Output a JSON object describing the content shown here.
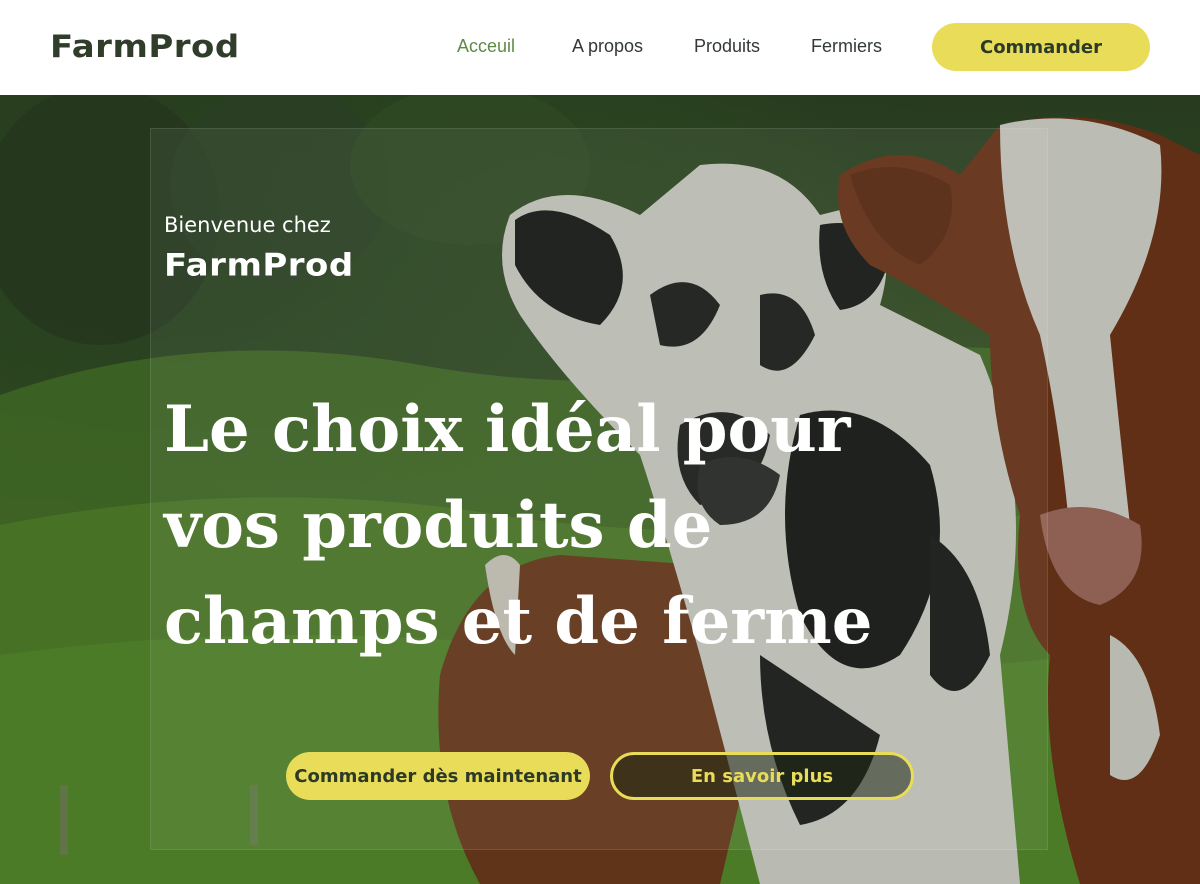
{
  "nav": {
    "brand": "FarmProd",
    "links": [
      {
        "label": "Acceuil",
        "active": true
      },
      {
        "label": "A propos",
        "active": false
      },
      {
        "label": "Produits",
        "active": false
      },
      {
        "label": "Fermiers",
        "active": false
      }
    ],
    "cta_label": "Commander"
  },
  "hero": {
    "welcome": "Bienvenue chez",
    "brand": "FarmProd",
    "headline": "Le choix idéal pour vos produits de champs et de ferme",
    "primary_button": "Commander dès maintenant",
    "secondary_button": "En savoir plus",
    "background_image": "cows-in-pasture-photo"
  },
  "colors": {
    "accent_yellow": "#e8dc58",
    "brand_dark_green": "#2f3d2a",
    "active_link_green": "#5f8a45"
  }
}
